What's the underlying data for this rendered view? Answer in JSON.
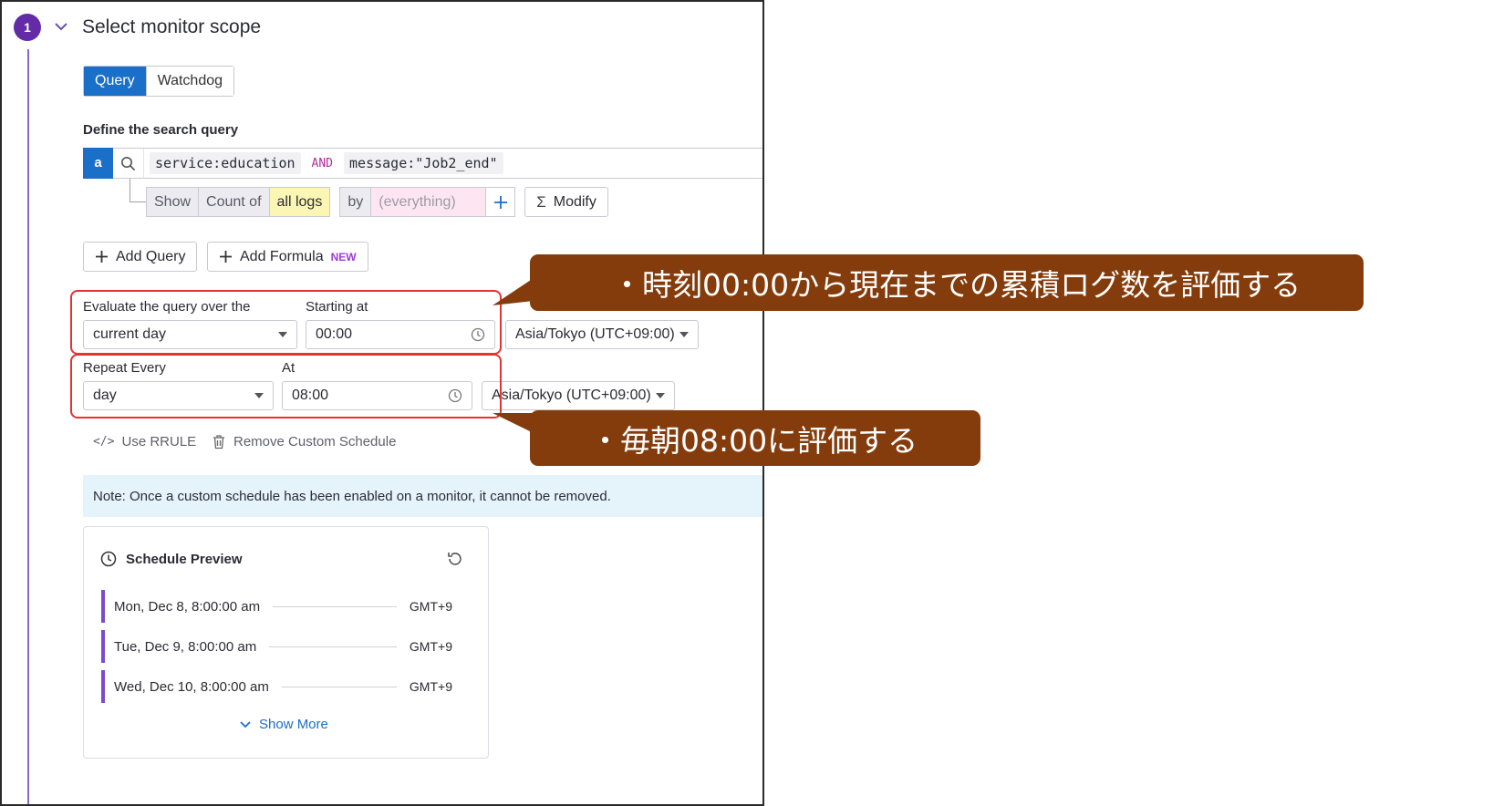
{
  "step": {
    "number": "1",
    "title": "Select monitor scope"
  },
  "tabs": [
    {
      "label": "Query",
      "active": true
    },
    {
      "label": "Watchdog",
      "active": false
    }
  ],
  "search": {
    "section_label": "Define the search query",
    "query_letter": "a",
    "term1": "service:education",
    "operator": "AND",
    "term2": "message:\"Job2_end\""
  },
  "aggregation": {
    "show": "Show",
    "count_of": "Count of",
    "target": "all logs",
    "by": "by",
    "group_placeholder": "(everything)",
    "modify": "Modify"
  },
  "actions": {
    "add_query": "Add Query",
    "add_formula": "Add Formula",
    "new_badge": "NEW"
  },
  "evaluation": {
    "window_label": "Evaluate the query over the",
    "window_value": "current day",
    "start_label": "Starting at",
    "start_value": "00:00",
    "timezone": "Asia/Tokyo (UTC+09:00)"
  },
  "schedule": {
    "repeat_label": "Repeat Every",
    "repeat_value": "day",
    "at_label": "At",
    "at_value": "08:00",
    "timezone": "Asia/Tokyo (UTC+09:00)",
    "use_rrule": "Use RRULE",
    "remove": "Remove Custom Schedule"
  },
  "note": "Note: Once a custom schedule has been enabled on a monitor, it cannot be removed.",
  "preview": {
    "title": "Schedule Preview",
    "rows": [
      {
        "date": "Mon, Dec 8, 8:00:00 am",
        "tz": "GMT+9"
      },
      {
        "date": "Tue, Dec 9, 8:00:00 am",
        "tz": "GMT+9"
      },
      {
        "date": "Wed, Dec 10, 8:00:00 am",
        "tz": "GMT+9"
      }
    ],
    "show_more": "Show More"
  },
  "callouts": {
    "top": "・時刻00:00から現在までの累積ログ数を評価する",
    "bottom": "・毎朝08:00に評価する"
  },
  "colors": {
    "accent_blue": "#1a6fc9",
    "step_purple": "#632ca6",
    "callout_brown": "#843c0c",
    "highlight_red": "#e53232"
  }
}
